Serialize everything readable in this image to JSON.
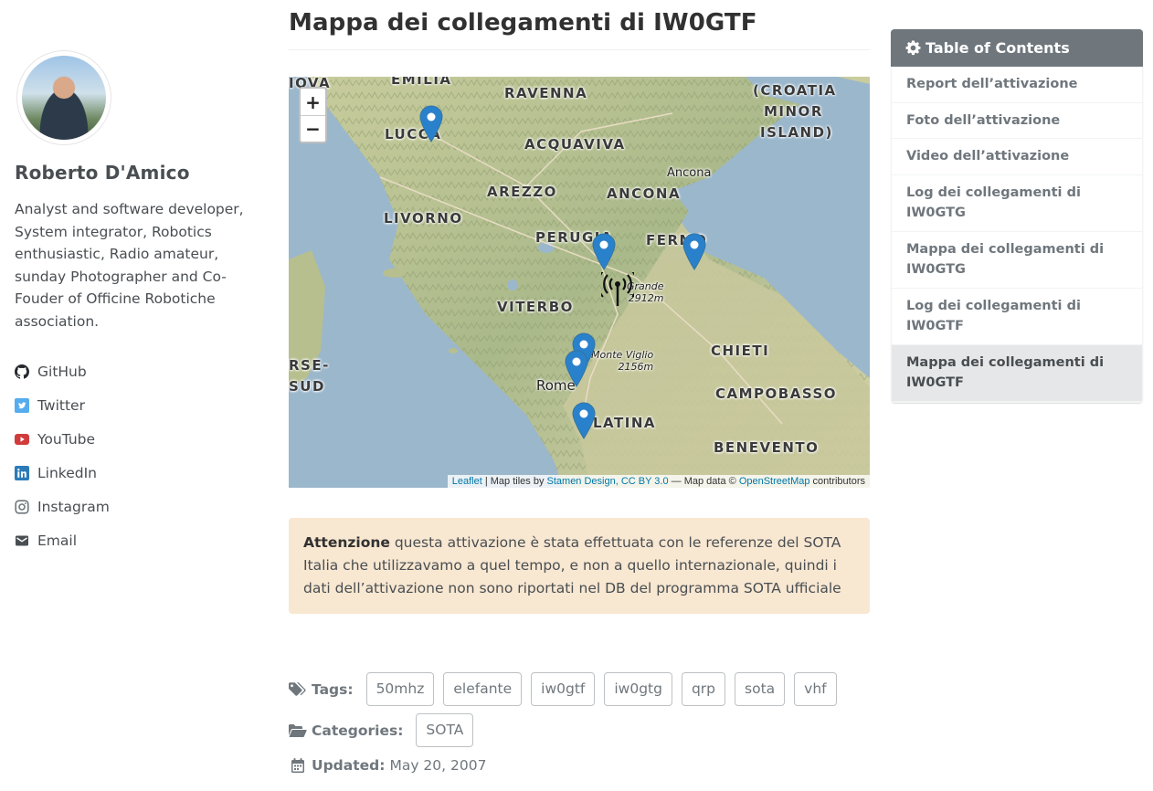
{
  "author": {
    "name": "Roberto D'Amico",
    "bio": "Analyst and software developer, System integrator, Robotics enthusiastic, Radio amateur, sunday Photographer and Co-Fouder of Officine Robotiche association.",
    "links": [
      {
        "label": "GitHub",
        "icon": "github-icon",
        "color": "#24292e"
      },
      {
        "label": "Twitter",
        "icon": "twitter-icon",
        "color": "#55acee"
      },
      {
        "label": "YouTube",
        "icon": "youtube-icon",
        "color": "#d13b3b"
      },
      {
        "label": "LinkedIn",
        "icon": "linkedin-icon",
        "color": "#2b7bb9"
      },
      {
        "label": "Instagram",
        "icon": "instagram-icon",
        "color": "#6f777d"
      },
      {
        "label": "Email",
        "icon": "envelope-icon",
        "color": "#494e52"
      }
    ]
  },
  "page": {
    "title": "Mappa dei collegamenti di IW0GTF"
  },
  "map": {
    "zoom_in": "+",
    "zoom_out": "−",
    "labels": {
      "ravenna": "RAVENNA",
      "croatia1": "(CROATIA",
      "croatia2": "MINOR",
      "croatia3": "ISLAND)",
      "emilia": "EMILIA",
      "iova": "IOVA",
      "lucca": "LUCCA",
      "acquaviva": "ACQUAVIVA",
      "ancona_city": "Ancona",
      "arezzo": "AREZZO",
      "ancona": "ANCONA",
      "livorno": "LIVORNO",
      "perugia": "PERUGIA",
      "fermo": "FERMO",
      "viterbo": "VITERBO",
      "chieti": "CHIETI",
      "rse": "RSE-",
      "sud": "SUD",
      "rome": "Rome",
      "campobasso": "CAMPOBASSO",
      "latina": "LATINA",
      "benevento": "BENEVENTO",
      "corno1": "Grande",
      "corno2": "2912m",
      "viglio1": "Monte Viglio",
      "viglio2": "2156m"
    },
    "attribution": {
      "leaflet": "Leaflet",
      "tiles_prefix": " | Map tiles by ",
      "stamen": "Stamen Design, CC BY 3.0",
      "data_prefix": " — Map data © ",
      "osm": "OpenStreetMap",
      "suffix": " contributors"
    }
  },
  "notice": {
    "bold": "Attenzione",
    "text": " questa attivazione è stata effettuata con le referenze del SOTA Italia che utilizzavamo a quel tempo, e non a quello internazionale, quindi i dati dell’attivazione non sono riportati nel DB del programma SOTA ufficiale"
  },
  "meta": {
    "tags_label": "Tags:",
    "tags": [
      "50mhz",
      "elefante",
      "iw0gtf",
      "iw0gtg",
      "qrp",
      "sota",
      "vhf"
    ],
    "categories_label": "Categories:",
    "categories": [
      "SOTA"
    ],
    "updated_label": "Updated:",
    "updated_value": "May 20, 2007"
  },
  "toc": {
    "title": "Table of Contents",
    "items": [
      "Report dell’attivazione",
      "Foto dell’attivazione",
      "Video dell’attivazione",
      "Log dei collegamenti di IW0GTG",
      "Mappa dei collegamenti di IW0GTG",
      "Log dei collegamenti di IW0GTF",
      "Mappa dei collegamenti di IW0GTF"
    ],
    "active_index": 6
  }
}
